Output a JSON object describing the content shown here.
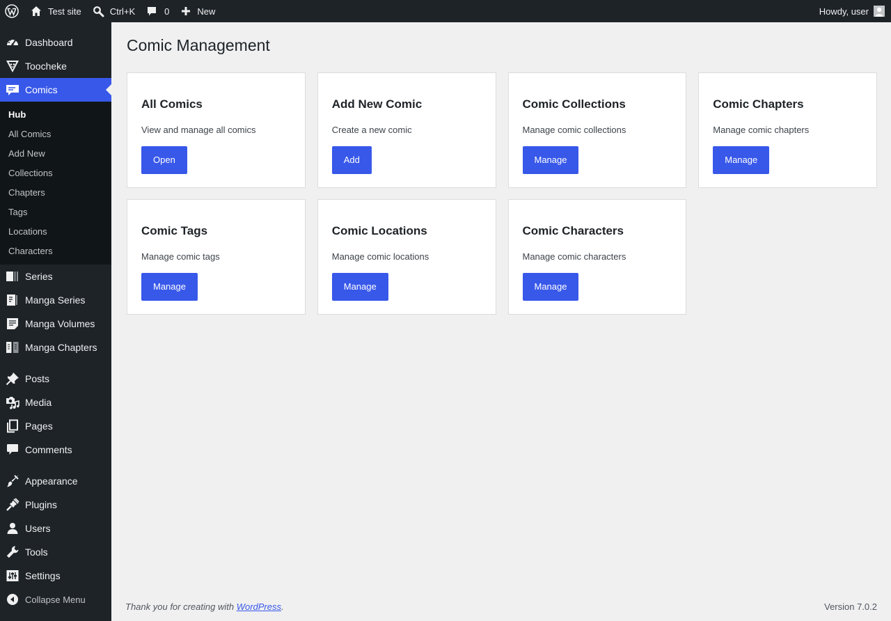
{
  "adminbar": {
    "site_name": "Test site",
    "search_label": "Ctrl+K",
    "comments_count": "0",
    "new_label": "New",
    "greeting": "Howdy, user"
  },
  "sidebar": {
    "top_items": [
      {
        "label": "Dashboard",
        "icon": "dashboard-icon"
      },
      {
        "label": "Toocheke",
        "icon": "toocheke-icon"
      },
      {
        "label": "Comics",
        "icon": "comics-icon"
      }
    ],
    "submenu": [
      {
        "label": "Hub"
      },
      {
        "label": "All Comics"
      },
      {
        "label": "Add New"
      },
      {
        "label": "Collections"
      },
      {
        "label": "Chapters"
      },
      {
        "label": "Tags"
      },
      {
        "label": "Locations"
      },
      {
        "label": "Characters"
      }
    ],
    "group2": [
      {
        "label": "Series",
        "icon": "series-icon"
      },
      {
        "label": "Manga Series",
        "icon": "manga-series-icon"
      },
      {
        "label": "Manga Volumes",
        "icon": "manga-volumes-icon"
      },
      {
        "label": "Manga Chapters",
        "icon": "manga-chapters-icon"
      }
    ],
    "group3": [
      {
        "label": "Posts",
        "icon": "pin-icon"
      },
      {
        "label": "Media",
        "icon": "media-icon"
      },
      {
        "label": "Pages",
        "icon": "pages-icon"
      },
      {
        "label": "Comments",
        "icon": "comment-icon"
      }
    ],
    "group4": [
      {
        "label": "Appearance",
        "icon": "brush-icon"
      },
      {
        "label": "Plugins",
        "icon": "plug-icon"
      },
      {
        "label": "Users",
        "icon": "user-icon"
      },
      {
        "label": "Tools",
        "icon": "wrench-icon"
      },
      {
        "label": "Settings",
        "icon": "sliders-icon"
      }
    ],
    "collapse_label": "Collapse Menu"
  },
  "main": {
    "title": "Comic Management",
    "cards": [
      {
        "title": "All Comics",
        "desc": "View and manage all comics",
        "button": "Open"
      },
      {
        "title": "Add New Comic",
        "desc": "Create a new comic",
        "button": "Add"
      },
      {
        "title": "Comic Collections",
        "desc": "Manage comic collections",
        "button": "Manage"
      },
      {
        "title": "Comic Chapters",
        "desc": "Manage comic chapters",
        "button": "Manage"
      },
      {
        "title": "Comic Tags",
        "desc": "Manage comic tags",
        "button": "Manage"
      },
      {
        "title": "Comic Locations",
        "desc": "Manage comic locations",
        "button": "Manage"
      },
      {
        "title": "Comic Characters",
        "desc": "Manage comic characters",
        "button": "Manage"
      }
    ]
  },
  "footer": {
    "thanks_prefix": "Thank you for creating with ",
    "wp_link": "WordPress",
    "thanks_suffix": ".",
    "version": "Version 7.0.2"
  },
  "colors": {
    "accent": "#3858e9",
    "sidebar_bg": "#1d2327",
    "submenu_bg": "#101517",
    "page_bg": "#f0f0f1"
  }
}
